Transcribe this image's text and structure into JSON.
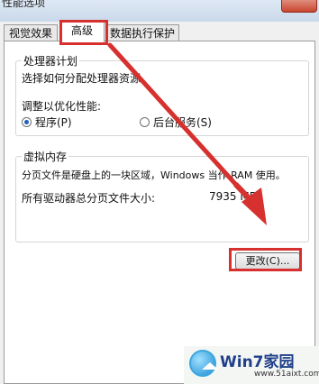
{
  "window": {
    "title": "性能选项"
  },
  "tabs": [
    {
      "label": "视觉效果"
    },
    {
      "label": "高级"
    },
    {
      "label": "数据执行保护"
    }
  ],
  "processor_scheduling": {
    "group_title": "处理器计划",
    "description": "选择如何分配处理器资源。",
    "adjust_label": "调整以优化性能:",
    "option_programs": "程序(P)",
    "option_background": "后台服务(S)",
    "selected": "programs"
  },
  "virtual_memory": {
    "group_title": "虚拟内存",
    "description": "分页文件是硬盘上的一块区域，Windows 当作 RAM 使用。",
    "total_label": "所有驱动器总分页文件大小:",
    "total_value": "7935 MB",
    "change_button": "更改(C)..."
  },
  "annotation": {
    "color": "#d6312e"
  },
  "watermark": {
    "brand": "Win7家园",
    "url": "www.51aixt.com"
  }
}
